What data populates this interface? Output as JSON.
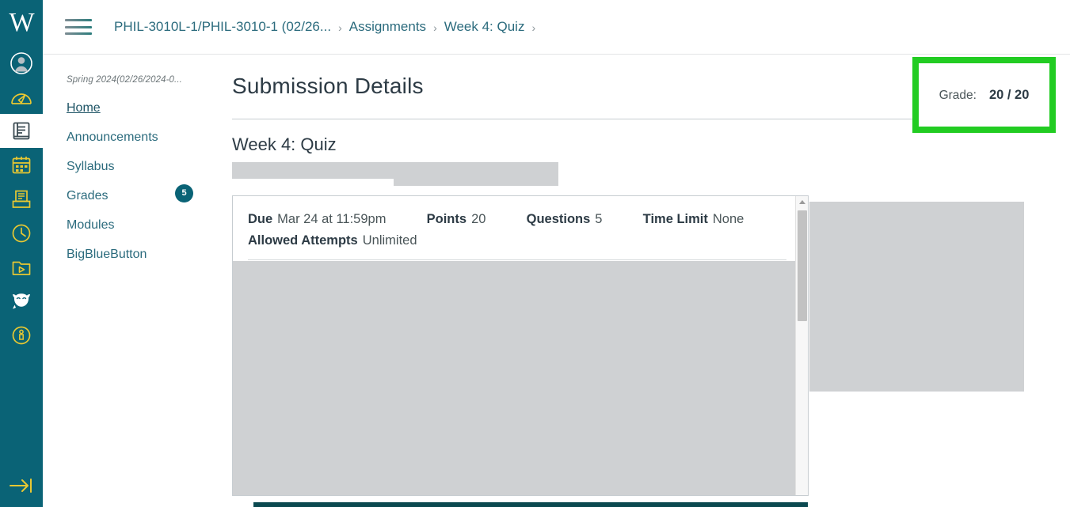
{
  "global_nav": {
    "logo_text": "W",
    "items": [
      {
        "name": "account",
        "icon": "user-circle-icon",
        "active": false
      },
      {
        "name": "dashboard",
        "icon": "dashboard-icon",
        "active": false
      },
      {
        "name": "courses",
        "icon": "book-icon",
        "active": true
      },
      {
        "name": "calendar",
        "icon": "calendar-icon",
        "active": false
      },
      {
        "name": "inbox",
        "icon": "inbox-icon",
        "active": false
      },
      {
        "name": "history",
        "icon": "clock-icon",
        "active": false
      },
      {
        "name": "studio",
        "icon": "folder-play-icon",
        "active": false
      },
      {
        "name": "bigbluebutton",
        "icon": "owl-icon",
        "active": false
      },
      {
        "name": "help",
        "icon": "info-circle-icon",
        "active": false
      }
    ],
    "collapse_icon": "arrow-to-right-icon"
  },
  "topbar": {
    "menu_icon": "hamburger-icon",
    "breadcrumbs": [
      "PHIL-3010L-1/PHIL-3010-1 (02/26...",
      "Assignments",
      "Week 4: Quiz"
    ],
    "separator": "›"
  },
  "course_nav": {
    "term": "Spring 2024(02/26/2024-0...",
    "items": [
      {
        "label": "Home",
        "active": true,
        "badge": null
      },
      {
        "label": "Announcements",
        "active": false,
        "badge": null
      },
      {
        "label": "Syllabus",
        "active": false,
        "badge": null
      },
      {
        "label": "Grades",
        "active": false,
        "badge": "5"
      },
      {
        "label": "Modules",
        "active": false,
        "badge": null
      },
      {
        "label": "BigBlueButton",
        "active": false,
        "badge": null
      }
    ]
  },
  "main": {
    "page_title": "Submission Details",
    "assignment_title": "Week 4: Quiz",
    "quiz_meta": {
      "due_label": "Due",
      "due_value": "Mar 24 at 11:59pm",
      "points_label": "Points",
      "points_value": "20",
      "questions_label": "Questions",
      "questions_value": "5",
      "time_limit_label": "Time Limit",
      "time_limit_value": "None",
      "attempts_label": "Allowed Attempts",
      "attempts_value": "Unlimited"
    }
  },
  "grade_box": {
    "label": "Grade:",
    "value": "20 / 20",
    "highlight_color": "#22cc22"
  },
  "colors": {
    "nav_teal": "#0a6376",
    "link_teal": "#2b6b7d",
    "text_dark": "#2d3b45",
    "redaction_gray": "#cfd1d3",
    "bottom_bar": "#0b4950"
  }
}
